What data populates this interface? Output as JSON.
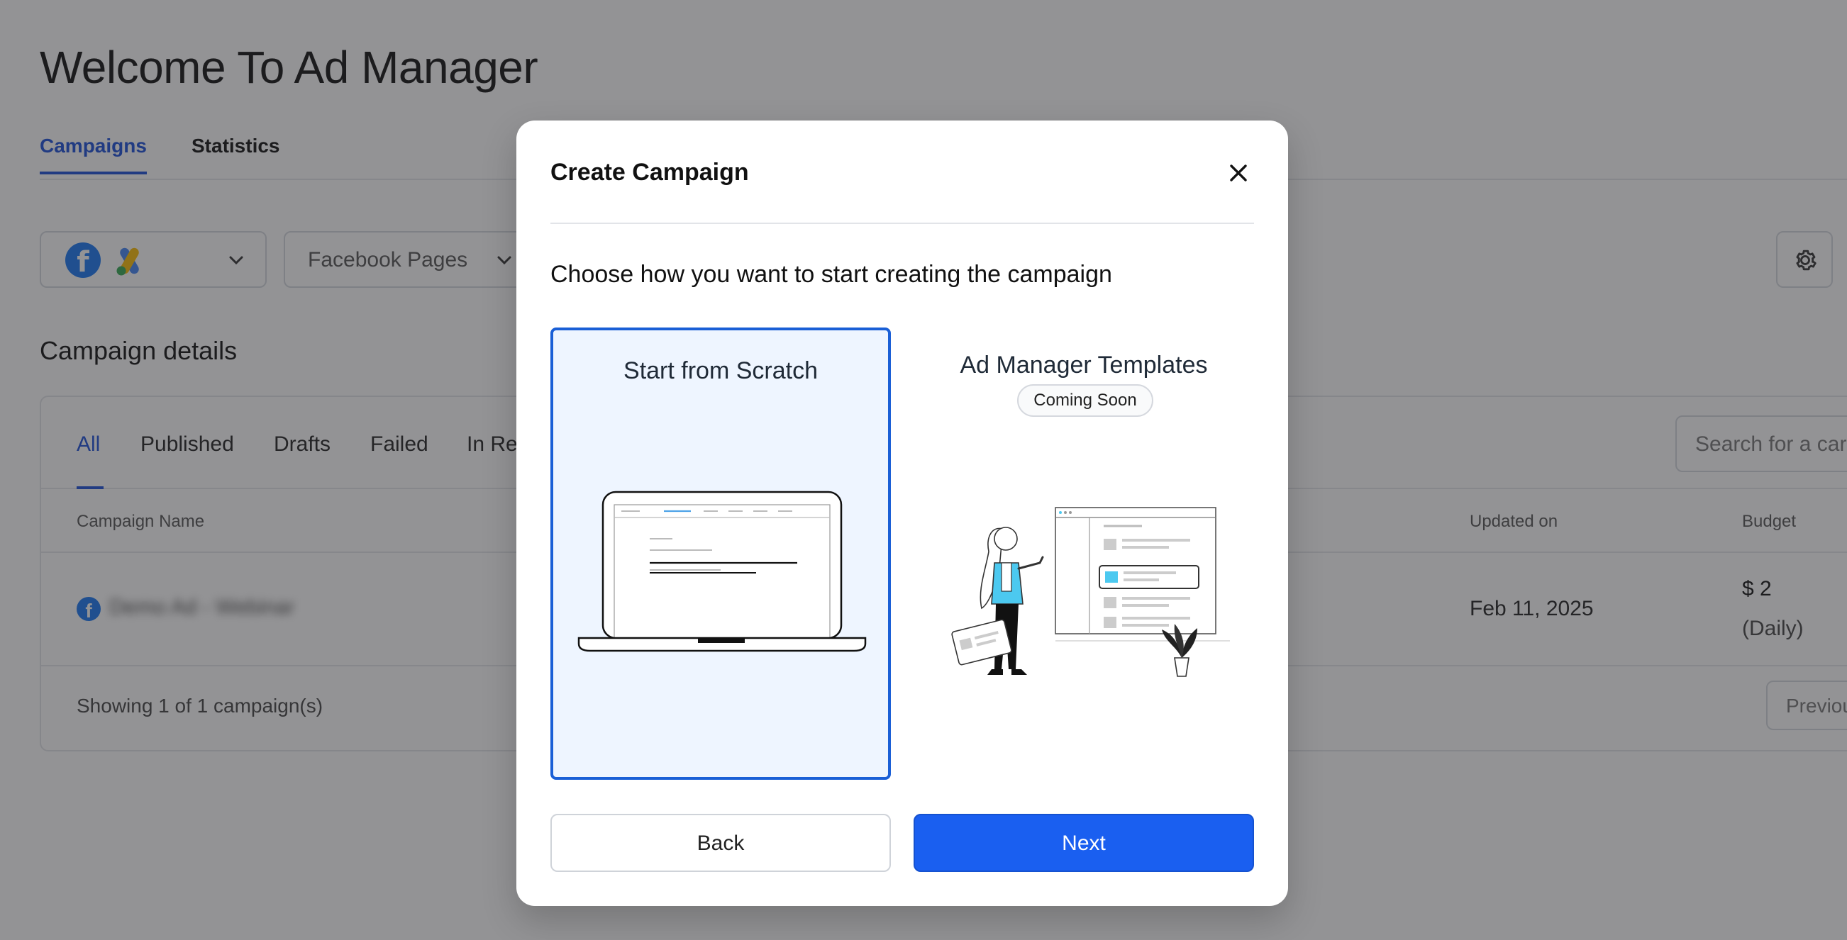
{
  "page": {
    "title": "Welcome To Ad Manager",
    "tabs": [
      {
        "label": "Campaigns",
        "active": true
      },
      {
        "label": "Statistics",
        "active": false
      }
    ],
    "pages_select_label": "Facebook Pages",
    "section_title": "Campaign details",
    "filter_tabs": [
      {
        "label": "All",
        "active": true
      },
      {
        "label": "Published"
      },
      {
        "label": "Drafts"
      },
      {
        "label": "Failed"
      },
      {
        "label": "In Rev"
      }
    ],
    "search_placeholder": "Search for a car",
    "table": {
      "headers": {
        "name": "Campaign Name",
        "updated": "Updated on",
        "budget": "Budget"
      },
      "row": {
        "name": "Demo Ad - Webinar",
        "updated_on": "Feb 11, 2025",
        "budget": "$ 2",
        "budget_period": "(Daily)"
      }
    },
    "footer_text": "Showing 1 of 1 campaign(s)",
    "previous_label": "Previou"
  },
  "modal": {
    "title": "Create Campaign",
    "prompt": "Choose how you want to start creating the campaign",
    "options": [
      {
        "label": "Start from Scratch",
        "selected": true
      },
      {
        "label": "Ad Manager Templates",
        "badge": "Coming Soon",
        "selected": false
      }
    ],
    "back_label": "Back",
    "next_label": "Next"
  },
  "colors": {
    "accent": "#1a5ff0",
    "accent_dark": "#1b4fd8",
    "selected_bg": "#eef5ff",
    "illustration_cyan": "#4cc9f0"
  },
  "icons": [
    "facebook-icon",
    "google-ads-icon",
    "chevron-down-icon",
    "gear-icon",
    "close-icon"
  ]
}
